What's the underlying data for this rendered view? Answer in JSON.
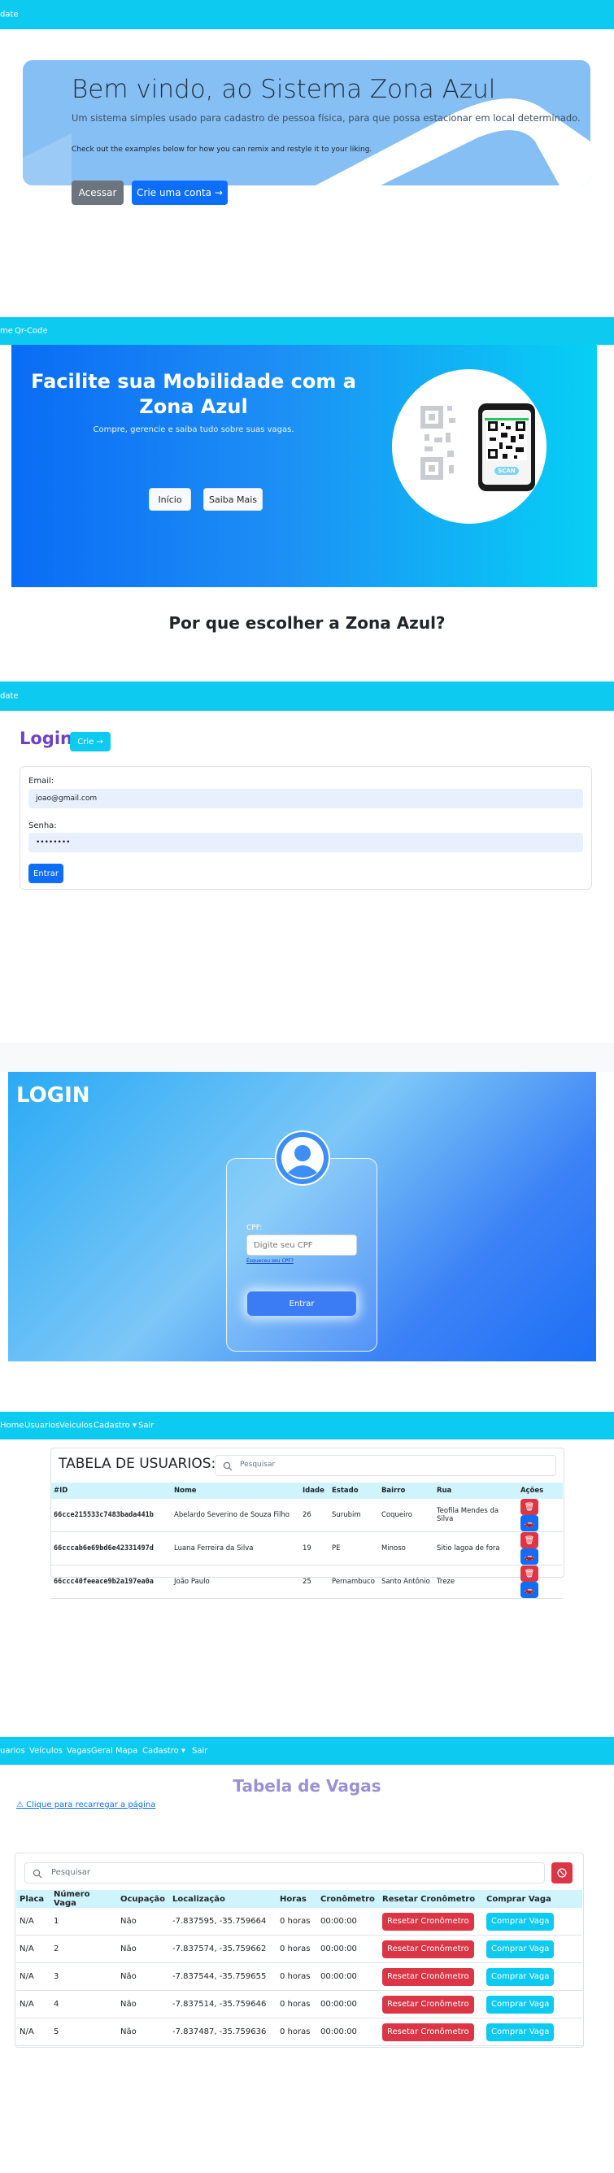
{
  "section1": {
    "navbar_brand": "date",
    "hero_title": "Bem vindo, ao Sistema Zona Azul",
    "hero_subtitle": "Um sistema simples usado para cadastro de pessoa física, para que possa estacionar em local determinado.",
    "hero_text": "Check out the examples below for how you can remix and restyle it to your liking.",
    "btn_access": "Acessar",
    "btn_create": "Crie uma conta →"
  },
  "section2": {
    "nav_items": [
      "me",
      "Qr-Code"
    ],
    "hero_title": "Facilite sua Mobilidade com a Zona Azul",
    "hero_subtitle": "Compre, gerencie e saiba tudo sobre suas vagas.",
    "btn_inicio": "Início",
    "btn_saiba": "Saiba Mais",
    "scan_label": "SCAN",
    "why_title": "Por que escolher a Zona Azul?"
  },
  "section3": {
    "navbar_brand": "date",
    "login_title": "Login:",
    "btn_crie": "Crie →",
    "email_label": "Email:",
    "email_value": "joao@gmail.com",
    "senha_label": "Senha:",
    "senha_value": "••••••••",
    "btn_entrar": "Entrar"
  },
  "section4": {
    "title": "LOGIN",
    "cpf_label": "CPF:",
    "cpf_placeholder": "Digite seu CPF",
    "link_text": "Esqueceu seu CPF?",
    "btn_entrar": "Entrar"
  },
  "section5": {
    "nav_items": [
      "Home",
      "Usuarios",
      "Veiculos",
      "Cadastro ▾",
      "Sair"
    ],
    "table_title": "TABELA DE USUARIOS:",
    "search_placeholder": "Pesquisar",
    "headers": [
      "#ID",
      "Nome",
      "Idade",
      "Estado",
      "Bairro",
      "Rua",
      "Ações"
    ],
    "rows": [
      [
        "66cce215533c7483bada441b",
        "Abelardo Severino de Souza Filho",
        "26",
        "Surubim",
        "Coqueiro",
        "Teofila Mendes da Silva"
      ],
      [
        "66cccab6e69bd6e42331497d",
        "Luana Ferreira da Silva",
        "19",
        "PE",
        "Minoso",
        "Sitio lagoa de fora"
      ],
      [
        "66ccc40feeace9b2a197ea0a",
        "João Paulo",
        "25",
        "Pernambuco",
        "Santo Antônio",
        "Treze"
      ]
    ]
  },
  "section6": {
    "nav_items": [
      "uarios",
      "Veículos",
      "VagasGeral",
      "Mapa",
      "Cadastro ▾",
      "Sair"
    ],
    "page_title": "Tabela de Vagas",
    "reload_link": "⚠ Clique para recarregar a página",
    "search_placeholder": "Pesquisar",
    "headers": [
      "Placa",
      "Número Vaga",
      "Ocupação",
      "Localização",
      "Horas",
      "Cronômetro",
      "Resetar Cronômetro",
      "Comprar Vaga"
    ],
    "rows": [
      [
        "N/A",
        "1",
        "Não",
        "-7.837595, -35.759664",
        "0 horas",
        "00:00:00"
      ],
      [
        "N/A",
        "2",
        "Não",
        "-7.837574, -35.759662",
        "0 horas",
        "00:00:00"
      ],
      [
        "N/A",
        "3",
        "Não",
        "-7.837544, -35.759655",
        "0 horas",
        "00:00:00"
      ],
      [
        "N/A",
        "4",
        "Não",
        "-7.837514, -35.759646",
        "0 horas",
        "00:00:00"
      ],
      [
        "N/A",
        "5",
        "Não",
        "-7.837487, -35.759636",
        "0 horas",
        "00:00:00"
      ]
    ],
    "reset_label": "Resetar Cronômetro",
    "buy_label": "Comprar Vaga"
  },
  "colors": {
    "navbar": "#0dcaf0",
    "primary": "#0d6efd",
    "danger": "#dc3545",
    "hero_blue": "#85bff4",
    "title_purple": "#9b8fd6"
  }
}
